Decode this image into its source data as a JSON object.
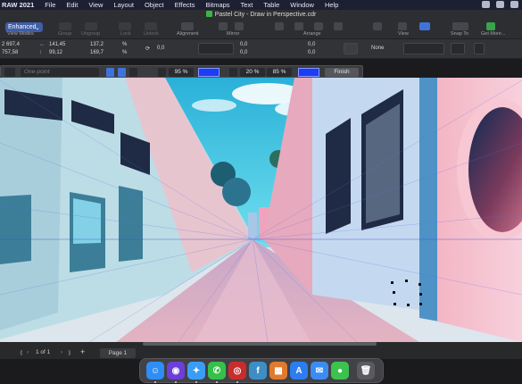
{
  "menubar": {
    "app_name": "RAW 2021",
    "items": [
      "File",
      "Edit",
      "View",
      "Layout",
      "Object",
      "Effects",
      "Bitmaps",
      "Text",
      "Table",
      "Window",
      "Help"
    ]
  },
  "window": {
    "title": "Pastel City - Draw in Perspective.cdr"
  },
  "toolbar": {
    "view_mode_value": "Enhanced",
    "labels": [
      "View Modes",
      "Group",
      "Ungroup",
      "Lock",
      "Unlock",
      "Alignment",
      "Mirror",
      "Arrange",
      "View",
      "Snap To",
      "Get More..."
    ]
  },
  "propbar": {
    "x": "2 697,4",
    "y": "757,58",
    "width": "141,45",
    "height": "99,12",
    "scale_w": "137,2",
    "scale_h": "169,7",
    "percent": "%",
    "angle": "0,0",
    "skew_h": "0,0",
    "skew_v": "0,0",
    "rot_a": "0,0",
    "rot_b": "0,0",
    "outline": "None"
  },
  "perspective": {
    "preset_placeholder": "One-point",
    "opacity_a": "95 %",
    "opacity_b": "20 %",
    "opacity_c": "85 %",
    "finish_label": "Finish",
    "color_a": "#1c3df5",
    "color_b": "#1c3df5",
    "color_c": "#1c3df5"
  },
  "pagebar": {
    "page_counter": "1 of 1",
    "page_tab": "Page 1"
  },
  "dock": {
    "apps": [
      {
        "name": "finder-icon",
        "color": "#2f8df5",
        "glyph": "☺"
      },
      {
        "name": "siri-icon",
        "color": "#6b3fd8",
        "glyph": "◉"
      },
      {
        "name": "safari-icon",
        "color": "#3a9df5",
        "glyph": "✦"
      },
      {
        "name": "facetime-icon",
        "color": "#36c04a",
        "glyph": "✆"
      },
      {
        "name": "photo-booth-icon",
        "color": "#c92c2c",
        "glyph": "◎"
      },
      {
        "name": "corel-icon",
        "color": "#3e8ec6",
        "glyph": "f"
      },
      {
        "name": "launchpad-icon",
        "color": "#e07a2e",
        "glyph": "▦"
      },
      {
        "name": "app-store-icon",
        "color": "#2d7df0",
        "glyph": "A"
      },
      {
        "name": "mail-icon",
        "color": "#3b8cf2",
        "glyph": "✉"
      },
      {
        "name": "messages-icon",
        "color": "#3cc24f",
        "glyph": "●"
      },
      {
        "name": "trash-icon",
        "color": "#5a5b60",
        "glyph": "🗑"
      }
    ]
  },
  "colors": {
    "brand_accent": "#3f5ea8",
    "sky": "#3ec3e6",
    "pink_wall": "#f2b9c8",
    "blue_wall": "#bfd8f2",
    "cobblestone": "#d9a9b8"
  }
}
